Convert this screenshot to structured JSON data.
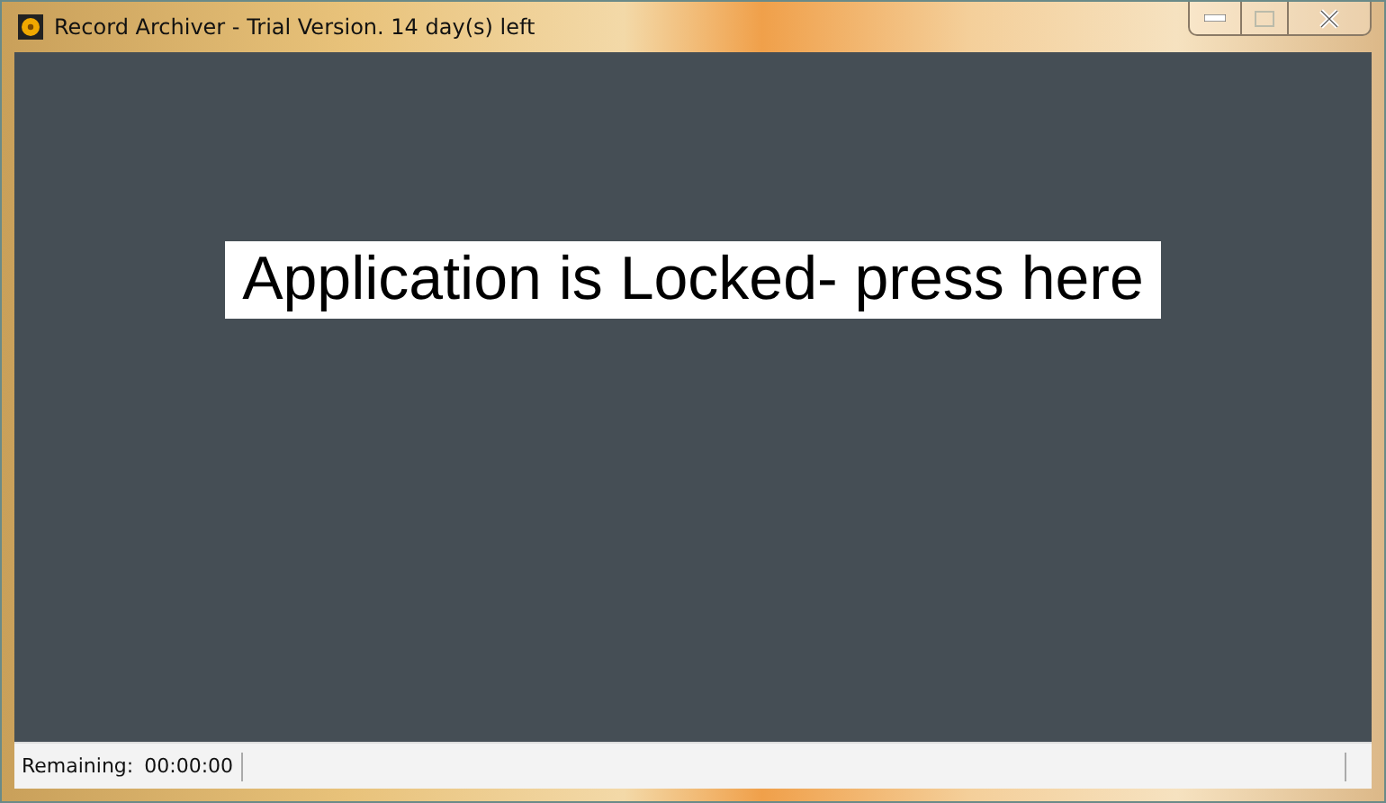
{
  "window": {
    "title": "Record Archiver - Trial Version. 14 day(s) left"
  },
  "lock_button": {
    "label": "Application is Locked- press here"
  },
  "status_bar": {
    "label": "Remaining:",
    "value": "00:00:00"
  }
}
